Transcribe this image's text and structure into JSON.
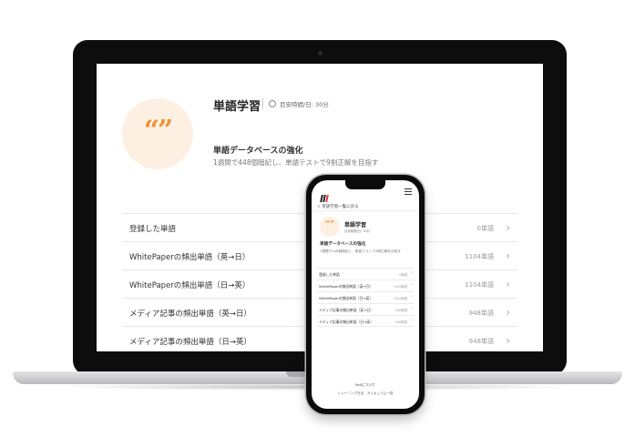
{
  "desktop": {
    "title": "単語学習",
    "target_time": "目安時間/日: 30分",
    "subtitle": "単語データベースの強化",
    "description": "1週間で448個暗記し、単語テストで9割正解を目指す",
    "quote_icon": "quote-icon",
    "accent_color": "#f0912e",
    "items": [
      {
        "label": "登録した単語",
        "count": "0単語"
      },
      {
        "label": "WhitePaperの頻出単語（英→日）",
        "count": "1104単語"
      },
      {
        "label": "WhitePaperの頻出単語（日→英）",
        "count": "1104単語"
      },
      {
        "label": "メディア記事の頻出単語（英→日）",
        "count": "948単語"
      },
      {
        "label": "メディア記事の頻出単語（日→英）",
        "count": "948単語"
      }
    ]
  },
  "mobile": {
    "back_link": "< 英語学習一覧に戻る",
    "title": "単語学習",
    "target_time": "目安時間/日: 30分",
    "subtitle": "単語データベースの強化",
    "description": "1週間で448個暗記し、単語テストで9割正解を目指す",
    "items": [
      {
        "label": "登録した単語",
        "count": "0単語"
      },
      {
        "label": "WhitePaperの頻出単語（英→日）",
        "count": "1104単語"
      },
      {
        "label": "WhitePaperの頻出単語（日→英）",
        "count": "1104単語"
      },
      {
        "label": "メディア記事の頻出単語（英→日）",
        "count": "948単語"
      },
      {
        "label": "メディア記事の頻出単語（日→英）",
        "count": "948単語"
      }
    ],
    "footer_about": "Pollについて",
    "footer_links": "トレーニング方法　カリキュラム一覧"
  }
}
